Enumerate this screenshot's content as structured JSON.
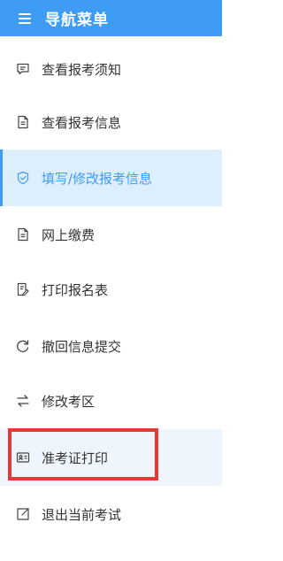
{
  "header": {
    "title": "导航菜单"
  },
  "menu": {
    "items": [
      {
        "label": "查看报考须知",
        "icon": "message-icon"
      },
      {
        "label": "查看报考信息",
        "icon": "document-icon"
      },
      {
        "label": "填写/修改报考信息",
        "icon": "shield-icon"
      },
      {
        "label": "网上缴费",
        "icon": "document-icon"
      },
      {
        "label": "打印报名表",
        "icon": "list-edit-icon"
      },
      {
        "label": "撤回信息提交",
        "icon": "undo-icon"
      },
      {
        "label": "修改考区",
        "icon": "swap-icon"
      },
      {
        "label": "准考证打印",
        "icon": "id-card-icon"
      },
      {
        "label": "退出当前考试",
        "icon": "exit-icon"
      }
    ]
  },
  "colors": {
    "header_bg": "#3f9cf5",
    "active_bg": "#ddeefc",
    "active_text": "#3f9cf5",
    "highlight_border": "#e53935"
  }
}
